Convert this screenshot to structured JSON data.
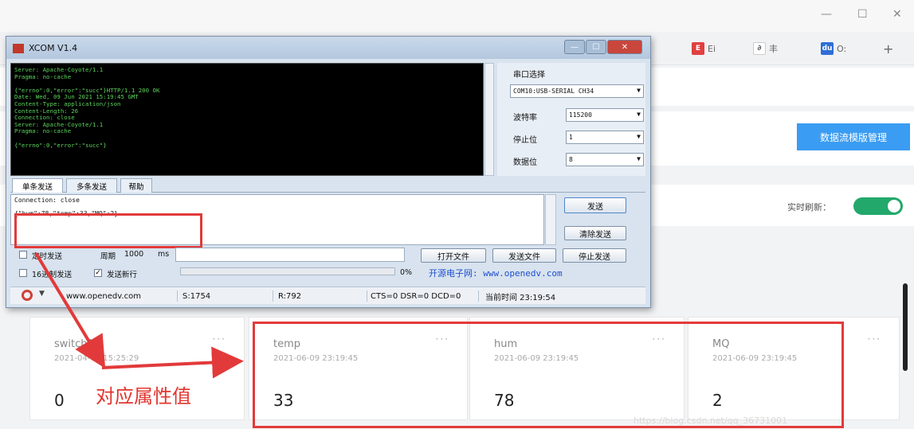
{
  "browser": {
    "window_controls": {
      "minimize": "—",
      "maximize": "☐",
      "close": "✕"
    },
    "tabs": [
      {
        "icon_text": "E",
        "label": "Ei",
        "icon_color": "#e04040"
      },
      {
        "icon_text": "∂",
        "label": "丰",
        "icon_color": "#888888"
      },
      {
        "icon_text": "du",
        "label": "O:",
        "icon_color": "#2f6ed8"
      }
    ],
    "new_tab": "+"
  },
  "page": {
    "mgmt_button": "数据流模版管理",
    "refresh_label": "实时刷新：",
    "cards": [
      {
        "name": "switch1",
        "time": "2021-04-08 15:25:29",
        "value": "0",
        "more": "···"
      },
      {
        "name": "temp",
        "time": "2021-06-09 23:19:45",
        "value": "33",
        "more": "···"
      },
      {
        "name": "hum",
        "time": "2021-06-09 23:19:45",
        "value": "78",
        "more": "···"
      },
      {
        "name": "MQ",
        "time": "2021-06-09 23:19:45",
        "value": "2",
        "more": "···"
      }
    ],
    "annotation": "对应属性值",
    "watermark": "https://blog.csdn.net/qq_36731001"
  },
  "xcom": {
    "title": "XCOM V1.4",
    "receive_text": "Server: Apache-Coyote/1.1\nPragma: no-cache\n\n{\"errno\":0,\"error\":\"succ\"}HTTP/1.1 200 OK\nDate: Wed, 09 Jun 2021 15:19:45 GMT\nContent-Type: application/json\nContent-Length: 26\nConnection: close\nServer: Apache-Coyote/1.1\nPragma: no-cache\n\n{\"errno\":0,\"error\":\"succ\"}",
    "side": {
      "port_select_label": "串口选择",
      "port_value": "COM10:USB-SERIAL CH34",
      "baud_label": "波特率",
      "baud_value": "115200",
      "stop_label": "停止位",
      "stop_value": "1",
      "data_label": "数据位",
      "data_value": "8"
    },
    "tabs": [
      "单条发送",
      "多条发送",
      "帮助"
    ],
    "send_text_line1": "Connection: close",
    "send_text_line2": "{\"hum\":78,\"temp\":33,\"MQ\":2}",
    "buttons": {
      "send": "发送",
      "clear_send": "清除发送",
      "open_file": "打开文件",
      "send_file": "发送文件",
      "stop_send": "停止发送"
    },
    "timed_send": "定时发送",
    "period_label": "周期",
    "period_value": "1000",
    "period_unit": "ms",
    "hex_send": "16进制发送",
    "send_newline": "发送新行",
    "progress_text": "0%",
    "opendev": "开源电子网: www.openedv.com",
    "status": {
      "site": "www.openedv.com",
      "s": "S:1754",
      "r": "R:792",
      "lines": "CTS=0 DSR=0 DCD=0",
      "time": "当前时间 23:19:54"
    }
  },
  "colors": {
    "accent_blue": "#3a9cf2",
    "toggle_green": "#22a86b",
    "annotation_red": "#e23a3a"
  }
}
